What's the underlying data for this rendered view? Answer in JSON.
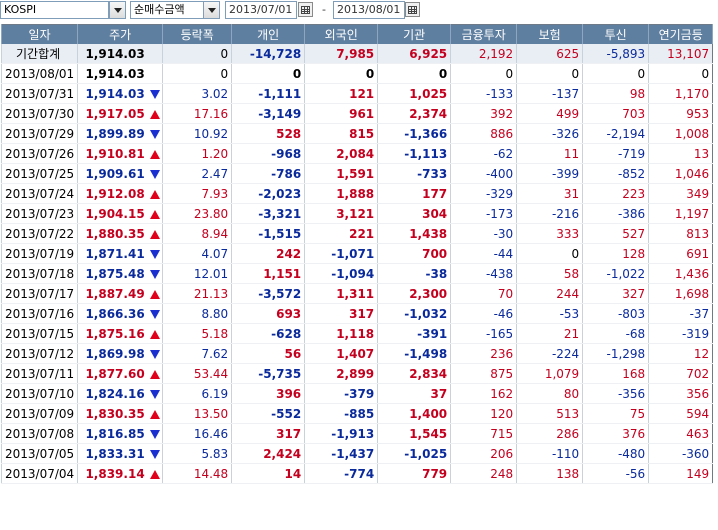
{
  "toolbar": {
    "market": "KOSPI",
    "metric": "순매수금액",
    "date_from": "2013/07/01",
    "date_to": "2013/08/01",
    "separator": "-"
  },
  "columns": [
    "일자",
    "주가",
    "등락폭",
    "개인",
    "외국인",
    "기관",
    "금융투자",
    "보험",
    "투신",
    "연기금등"
  ],
  "colors": {
    "header_bg": "#5f7fa0",
    "up": "#c4001f",
    "down": "#0a2a9c",
    "total_row_bg": "#e9eef5"
  },
  "total": {
    "date": "기간합계",
    "price": "1,914.03",
    "change": "0",
    "indiv": "-14,728",
    "foreign": "7,985",
    "inst": "6,925",
    "fin": "2,192",
    "ins": "625",
    "trust": "-5,893",
    "pension": "13,107"
  },
  "rows": [
    {
      "date": "2013/08/01",
      "price": "1,914.03",
      "dir": "flat",
      "change": "0",
      "indiv": "0",
      "foreign": "0",
      "inst": "0",
      "fin": "0",
      "ins": "0",
      "trust": "0",
      "pension": "0"
    },
    {
      "date": "2013/07/31",
      "price": "1,914.03",
      "dir": "down",
      "change": "3.02",
      "indiv": "-1,111",
      "foreign": "121",
      "inst": "1,025",
      "fin": "-133",
      "ins": "-137",
      "trust": "98",
      "pension": "1,170"
    },
    {
      "date": "2013/07/30",
      "price": "1,917.05",
      "dir": "up",
      "change": "17.16",
      "indiv": "-3,149",
      "foreign": "961",
      "inst": "2,374",
      "fin": "392",
      "ins": "499",
      "trust": "703",
      "pension": "953"
    },
    {
      "date": "2013/07/29",
      "price": "1,899.89",
      "dir": "down",
      "change": "10.92",
      "indiv": "528",
      "foreign": "815",
      "inst": "-1,366",
      "fin": "886",
      "ins": "-326",
      "trust": "-2,194",
      "pension": "1,008"
    },
    {
      "date": "2013/07/26",
      "price": "1,910.81",
      "dir": "up",
      "change": "1.20",
      "indiv": "-968",
      "foreign": "2,084",
      "inst": "-1,113",
      "fin": "-62",
      "ins": "11",
      "trust": "-719",
      "pension": "13"
    },
    {
      "date": "2013/07/25",
      "price": "1,909.61",
      "dir": "down",
      "change": "2.47",
      "indiv": "-786",
      "foreign": "1,591",
      "inst": "-733",
      "fin": "-400",
      "ins": "-399",
      "trust": "-852",
      "pension": "1,046"
    },
    {
      "date": "2013/07/24",
      "price": "1,912.08",
      "dir": "up",
      "change": "7.93",
      "indiv": "-2,023",
      "foreign": "1,888",
      "inst": "177",
      "fin": "-329",
      "ins": "31",
      "trust": "223",
      "pension": "349"
    },
    {
      "date": "2013/07/23",
      "price": "1,904.15",
      "dir": "up",
      "change": "23.80",
      "indiv": "-3,321",
      "foreign": "3,121",
      "inst": "304",
      "fin": "-173",
      "ins": "-216",
      "trust": "-386",
      "pension": "1,197"
    },
    {
      "date": "2013/07/22",
      "price": "1,880.35",
      "dir": "up",
      "change": "8.94",
      "indiv": "-1,515",
      "foreign": "221",
      "inst": "1,438",
      "fin": "-30",
      "ins": "333",
      "trust": "527",
      "pension": "813"
    },
    {
      "date": "2013/07/19",
      "price": "1,871.41",
      "dir": "down",
      "change": "4.07",
      "indiv": "242",
      "foreign": "-1,071",
      "inst": "700",
      "fin": "-44",
      "ins": "0",
      "trust": "128",
      "pension": "691"
    },
    {
      "date": "2013/07/18",
      "price": "1,875.48",
      "dir": "down",
      "change": "12.01",
      "indiv": "1,151",
      "foreign": "-1,094",
      "inst": "-38",
      "fin": "-438",
      "ins": "58",
      "trust": "-1,022",
      "pension": "1,436"
    },
    {
      "date": "2013/07/17",
      "price": "1,887.49",
      "dir": "up",
      "change": "21.13",
      "indiv": "-3,572",
      "foreign": "1,311",
      "inst": "2,300",
      "fin": "70",
      "ins": "244",
      "trust": "327",
      "pension": "1,698"
    },
    {
      "date": "2013/07/16",
      "price": "1,866.36",
      "dir": "down",
      "change": "8.80",
      "indiv": "693",
      "foreign": "317",
      "inst": "-1,032",
      "fin": "-46",
      "ins": "-53",
      "trust": "-803",
      "pension": "-37"
    },
    {
      "date": "2013/07/15",
      "price": "1,875.16",
      "dir": "up",
      "change": "5.18",
      "indiv": "-628",
      "foreign": "1,118",
      "inst": "-391",
      "fin": "-165",
      "ins": "21",
      "trust": "-68",
      "pension": "-319"
    },
    {
      "date": "2013/07/12",
      "price": "1,869.98",
      "dir": "down",
      "change": "7.62",
      "indiv": "56",
      "foreign": "1,407",
      "inst": "-1,498",
      "fin": "236",
      "ins": "-224",
      "trust": "-1,298",
      "pension": "12"
    },
    {
      "date": "2013/07/11",
      "price": "1,877.60",
      "dir": "up",
      "change": "53.44",
      "indiv": "-5,735",
      "foreign": "2,899",
      "inst": "2,834",
      "fin": "875",
      "ins": "1,079",
      "trust": "168",
      "pension": "702"
    },
    {
      "date": "2013/07/10",
      "price": "1,824.16",
      "dir": "down",
      "change": "6.19",
      "indiv": "396",
      "foreign": "-379",
      "inst": "37",
      "fin": "162",
      "ins": "80",
      "trust": "-356",
      "pension": "356"
    },
    {
      "date": "2013/07/09",
      "price": "1,830.35",
      "dir": "up",
      "change": "13.50",
      "indiv": "-552",
      "foreign": "-885",
      "inst": "1,400",
      "fin": "120",
      "ins": "513",
      "trust": "75",
      "pension": "594"
    },
    {
      "date": "2013/07/08",
      "price": "1,816.85",
      "dir": "down",
      "change": "16.46",
      "indiv": "317",
      "foreign": "-1,913",
      "inst": "1,545",
      "fin": "715",
      "ins": "286",
      "trust": "376",
      "pension": "463"
    },
    {
      "date": "2013/07/05",
      "price": "1,833.31",
      "dir": "down",
      "change": "5.83",
      "indiv": "2,424",
      "foreign": "-1,437",
      "inst": "-1,025",
      "fin": "206",
      "ins": "-110",
      "trust": "-480",
      "pension": "-360"
    },
    {
      "date": "2013/07/04",
      "price": "1,839.14",
      "dir": "up",
      "change": "14.48",
      "indiv": "14",
      "foreign": "-774",
      "inst": "779",
      "fin": "248",
      "ins": "138",
      "trust": "-56",
      "pension": "149"
    }
  ]
}
